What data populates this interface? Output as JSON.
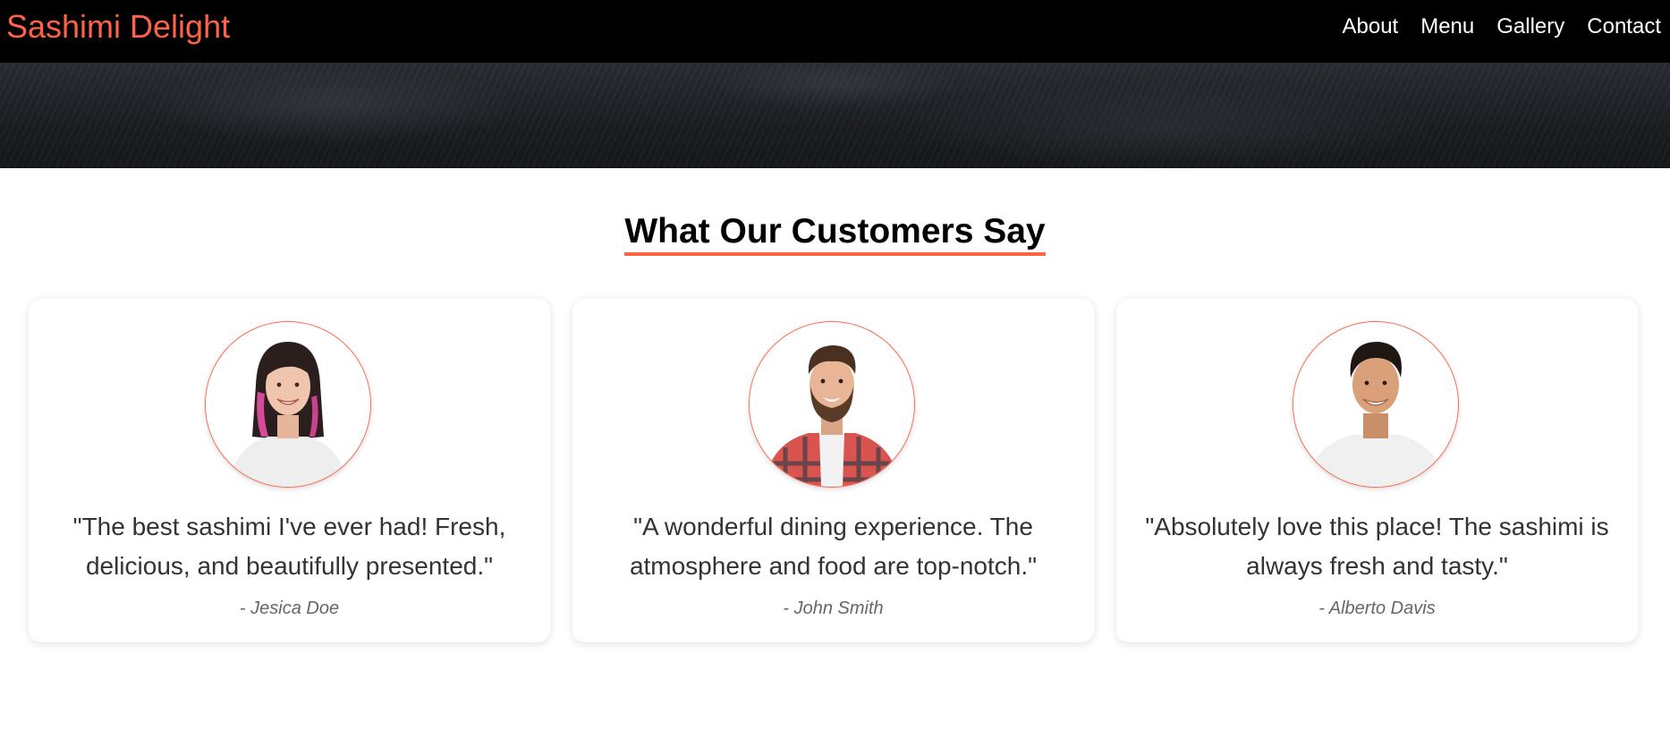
{
  "navbar": {
    "brand": "Sashimi Delight",
    "links": [
      "About",
      "Menu",
      "Gallery",
      "Contact"
    ]
  },
  "testimonials": {
    "title": "What Our Customers Say",
    "items": [
      {
        "quote": "\"The best sashimi I've ever had! Fresh, delicious, and beautifully presented.\"",
        "author": "- Jesica Doe",
        "avatar": "woman-avatar"
      },
      {
        "quote": "\"A wonderful dining experience. The atmosphere and food are top-notch.\"",
        "author": "- John Smith",
        "avatar": "bearded-man-avatar"
      },
      {
        "quote": "\"Absolutely love this place! The sashimi is always fresh and tasty.\"",
        "author": "- Alberto Davis",
        "avatar": "man-avatar"
      }
    ]
  },
  "colors": {
    "accent": "#ff6347",
    "navbar_bg": "#000000",
    "text": "#333333",
    "author": "#666666"
  }
}
